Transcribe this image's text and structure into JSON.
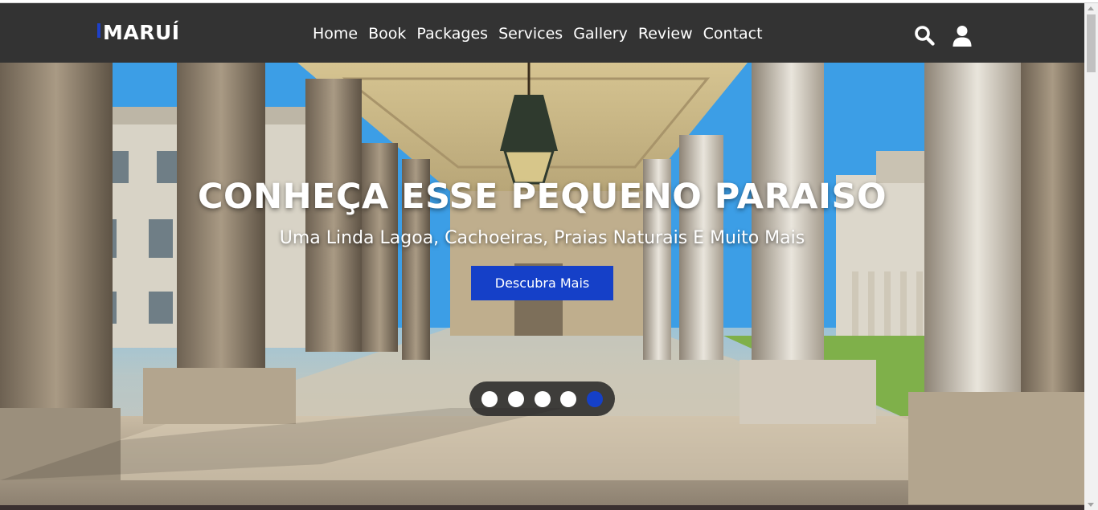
{
  "header": {
    "logo": "MARUÍ",
    "nav": [
      "Home",
      "Book",
      "Packages",
      "Services",
      "Gallery",
      "Review",
      "Contact"
    ],
    "icons": [
      "search-icon",
      "user-icon"
    ]
  },
  "hero": {
    "title": "CONHEÇA ESSE PEQUENO PARAISO",
    "subtitle": "Uma Linda Lagoa, Cachoeiras, Praias Naturais E Muito Mais",
    "button": "Descubra Mais",
    "slider": {
      "total_slides": 5,
      "active_slide": 5
    }
  },
  "colors": {
    "header_bg": "#333333",
    "accent": "#1540c8",
    "text": "#ffffff"
  }
}
